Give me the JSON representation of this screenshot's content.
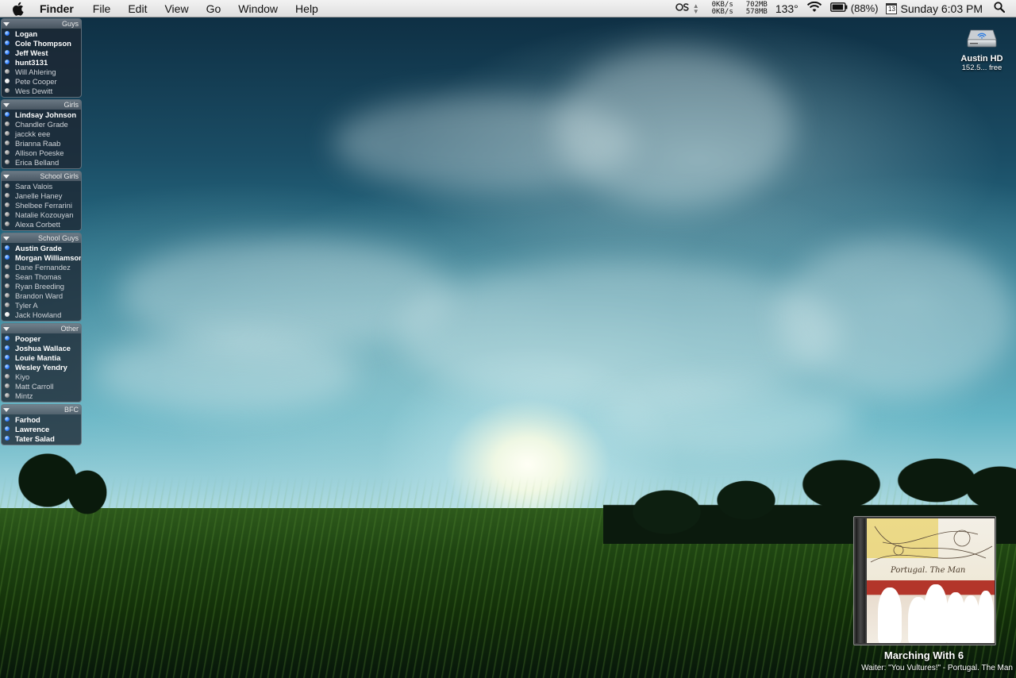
{
  "menubar": {
    "app_name": "Finder",
    "menus": [
      "File",
      "Edit",
      "View",
      "Go",
      "Window",
      "Help"
    ],
    "net_up": "0KB/s",
    "net_down": "0KB/s",
    "mem_free": "702MB",
    "mem_used": "578MB",
    "temperature": "133°",
    "battery": "(88%)",
    "calendar_day": "13",
    "clock": "Sunday 6:03 PM"
  },
  "buddy_groups": [
    {
      "name": "Guys",
      "buddies": [
        {
          "name": "Logan",
          "status": "online",
          "active": true
        },
        {
          "name": "Cole Thompson",
          "status": "online",
          "active": true
        },
        {
          "name": "Jeff West",
          "status": "online",
          "active": true
        },
        {
          "name": "hunt3131",
          "status": "online",
          "active": true
        },
        {
          "name": "Will Ahlering",
          "status": "idle",
          "active": false
        },
        {
          "name": "Pete Cooper",
          "status": "white",
          "active": false
        },
        {
          "name": "Wes Dewitt",
          "status": "idle",
          "active": false
        }
      ]
    },
    {
      "name": "Girls",
      "buddies": [
        {
          "name": "Lindsay Johnson",
          "status": "online",
          "active": true
        },
        {
          "name": "Chandler Grade",
          "status": "idle",
          "active": false
        },
        {
          "name": "jacckk eee",
          "status": "idle",
          "active": false
        },
        {
          "name": "Brianna Raab",
          "status": "idle",
          "active": false
        },
        {
          "name": "Allison Poeske",
          "status": "idle",
          "active": false
        },
        {
          "name": "Erica Belland",
          "status": "idle",
          "active": false
        }
      ]
    },
    {
      "name": "School Girls",
      "buddies": [
        {
          "name": "Sara Valois",
          "status": "idle",
          "active": false
        },
        {
          "name": "Janelle Haney",
          "status": "idle",
          "active": false
        },
        {
          "name": "Shelbee Ferrarini",
          "status": "idle",
          "active": false
        },
        {
          "name": "Natalie Kozouyan",
          "status": "idle",
          "active": false
        },
        {
          "name": "Alexa Corbett",
          "status": "idle",
          "active": false
        }
      ]
    },
    {
      "name": "School Guys",
      "buddies": [
        {
          "name": "Austin Grade",
          "status": "online",
          "active": true
        },
        {
          "name": "Morgan Williamson",
          "status": "online",
          "active": true
        },
        {
          "name": "Dane Fernandez",
          "status": "idle",
          "active": false
        },
        {
          "name": "Sean Thomas",
          "status": "idle",
          "active": false
        },
        {
          "name": "Ryan Breeding",
          "status": "idle",
          "active": false
        },
        {
          "name": "Brandon Ward",
          "status": "idle",
          "active": false
        },
        {
          "name": "Tyler A",
          "status": "idle",
          "active": false
        },
        {
          "name": "Jack Howland",
          "status": "white",
          "active": false
        }
      ]
    },
    {
      "name": "Other",
      "buddies": [
        {
          "name": "Pooper",
          "status": "online",
          "active": true
        },
        {
          "name": "Joshua Wallace",
          "status": "online",
          "active": true
        },
        {
          "name": "Louie Mantia",
          "status": "online",
          "active": true
        },
        {
          "name": "Wesley Yendry",
          "status": "online",
          "active": true
        },
        {
          "name": "Kiyo",
          "status": "idle",
          "active": false
        },
        {
          "name": "Matt Carroll",
          "status": "idle",
          "active": false
        },
        {
          "name": "Mintz",
          "status": "idle",
          "active": false
        }
      ]
    },
    {
      "name": "BFC",
      "buddies": [
        {
          "name": "Farhod",
          "status": "online",
          "active": true
        },
        {
          "name": "Lawrence",
          "status": "online",
          "active": true
        },
        {
          "name": "Tater Salad",
          "status": "online",
          "active": true
        }
      ]
    }
  ],
  "desktop": {
    "disk_name": "Austin HD",
    "disk_free": "152.5... free"
  },
  "now_playing": {
    "album": "Marching With 6",
    "track_line": "Waiter: \"You Vultures!\" - Portugal. The Man",
    "cover_text": "Portugal. The Man"
  },
  "icons": {
    "apple": "apple-icon",
    "wifi": "wifi-icon",
    "battery": "battery-icon",
    "search": "search-icon",
    "disk": "hard-disk-icon"
  }
}
